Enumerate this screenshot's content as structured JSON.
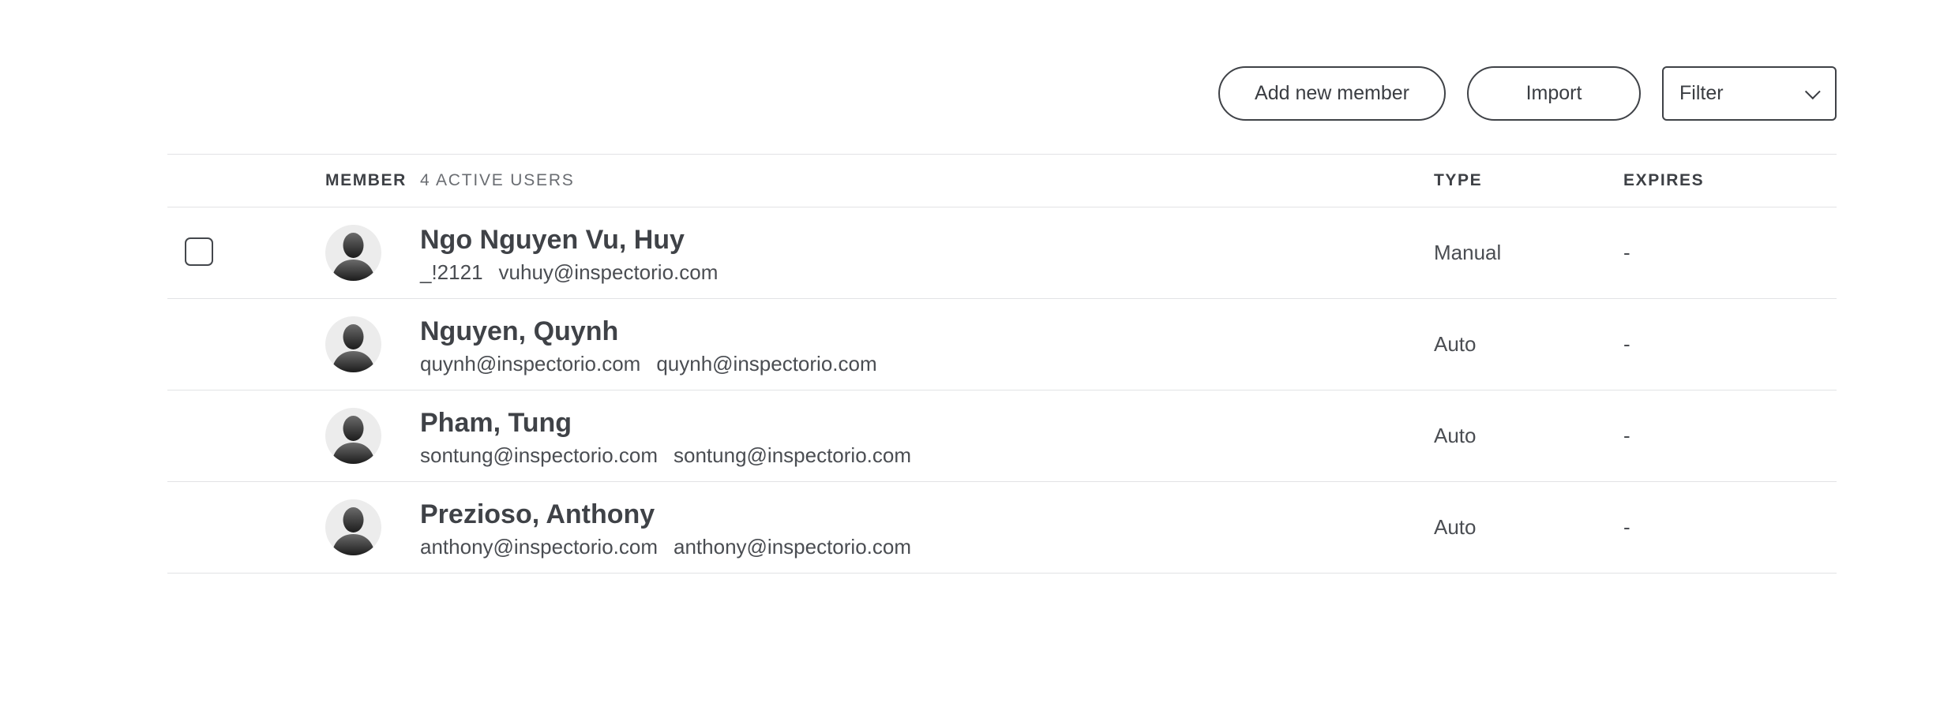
{
  "toolbar": {
    "add_label": "Add new member",
    "import_label": "Import",
    "filter_value": "Filter",
    "filter_icon": "chevron-down-icon"
  },
  "table": {
    "header": {
      "member": "MEMBER",
      "active_count": "4 ACTIVE USERS",
      "type": "TYPE",
      "expires": "EXPIRES"
    },
    "rows": [
      {
        "name": "Ngo Nguyen Vu, Huy",
        "username": "_!2121",
        "email": "vuhuy@inspectorio.com",
        "type": "Manual",
        "expires": "-"
      },
      {
        "name": "Nguyen, Quynh",
        "username": "quynh@inspectorio.com",
        "email": "quynh@inspectorio.com",
        "type": "Auto",
        "expires": "-"
      },
      {
        "name": "Pham, Tung",
        "username": "sontung@inspectorio.com",
        "email": "sontung@inspectorio.com",
        "type": "Auto",
        "expires": "-"
      },
      {
        "name": "Prezioso, Anthony",
        "username": "anthony@inspectorio.com",
        "email": "anthony@inspectorio.com",
        "type": "Auto",
        "expires": "-"
      }
    ]
  },
  "icons": {
    "avatar": "user-silhouette-icon"
  },
  "colors": {
    "text": "#3f4247",
    "border": "#e2e3e5",
    "avatar_bg": "#ececec"
  }
}
